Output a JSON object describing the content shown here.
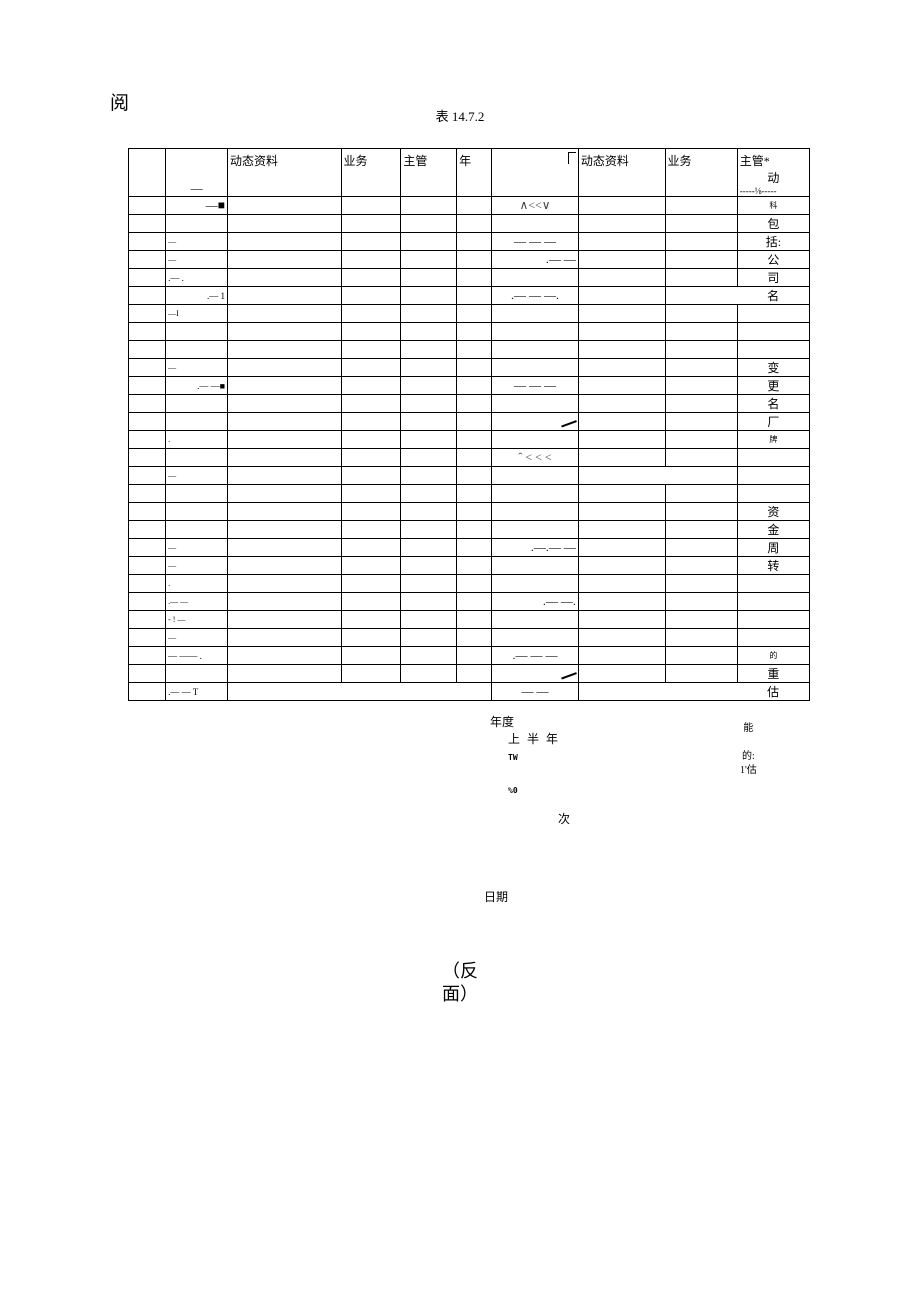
{
  "yue": "阅",
  "table_title": "表 14.7.2",
  "headers": {
    "c2": "动态资料",
    "c3": "业务",
    "c4": "主管",
    "c5": "年",
    "c7": "动态资料",
    "c8": "业务",
    "c9": "主管*"
  },
  "side_text": {
    "dong": "动",
    "sec1_line": "⅛",
    "ke": "科",
    "bao": "包",
    "kuo": "括:",
    "gong": "公",
    "si": "司",
    "ming": "名",
    "bian": "变",
    "geng": "更",
    "ming2": "名",
    "chang": "厂",
    "pai": "牌",
    "zi": "资",
    "jin": "金",
    "zhou": "周",
    "zhuan": "转",
    "de": "的",
    "chong": "重",
    "gu": "估",
    "neng": "能",
    "de2": "的:",
    "gu2": "1'估"
  },
  "c6_vals": {
    "r2": "∧<<∨",
    "r15": "ˆ < < <"
  },
  "bottom": {
    "niandu": "年度",
    "shangbannian": "上 半 年",
    "tw": "TW",
    "pct": "%0",
    "ci": "次",
    "riqi": "日期"
  },
  "fanmian_l1": "（反",
  "fanmian_l2": "面）"
}
